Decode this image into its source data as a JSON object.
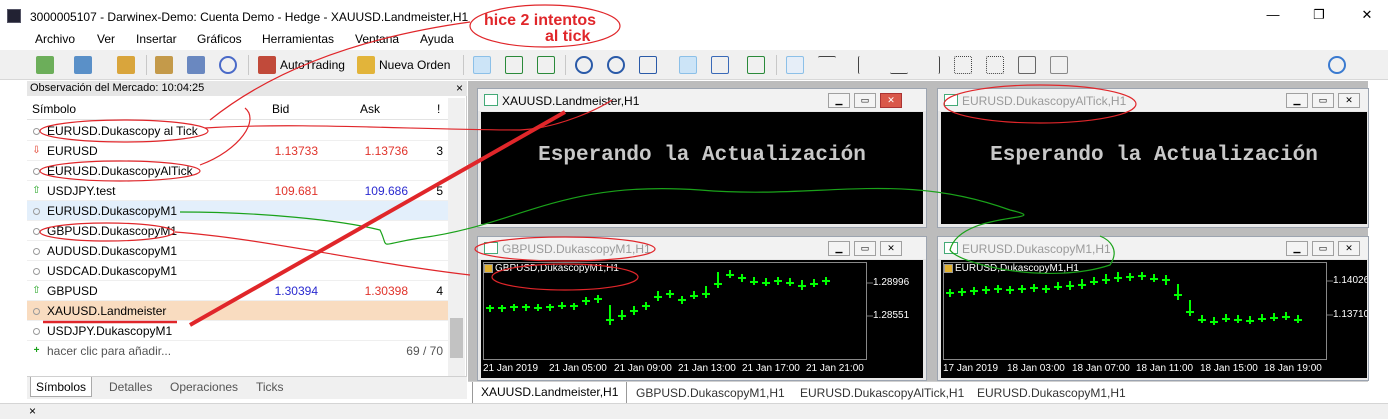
{
  "window": {
    "title": "3000005107 - Darwinex-Demo: Cuenta Demo - Hedge - XAUUSD.Landmeister,H1",
    "minimize": "—",
    "maximize": "❐",
    "close": "✕"
  },
  "menu": [
    "Archivo",
    "Ver",
    "Insertar",
    "Gráficos",
    "Herramientas",
    "Ventana",
    "Ayuda"
  ],
  "toolbar": {
    "autotrading_label": "AutoTrading",
    "new_order_label": "Nueva Orden"
  },
  "annotation": {
    "line1": "hice 2 intentos",
    "line2": "al tick"
  },
  "market_watch": {
    "header": "Observación del Mercado: 10:04:25",
    "close": "×",
    "columns": {
      "symbol": "Símbolo",
      "bid": "Bid",
      "ask": "Ask",
      "spread": "!"
    },
    "rows": [
      {
        "symbol": "EURUSD.Dukascopy al Tick",
        "bid": "",
        "ask": "",
        "spread": "",
        "icon": "dot"
      },
      {
        "symbol": "EURUSD",
        "bid": "1.13733",
        "ask": "1.13736",
        "spread": "3",
        "icon": "down-arrow"
      },
      {
        "symbol": "EURUSD.DukascopyAlTick",
        "bid": "",
        "ask": "",
        "spread": "",
        "icon": "dot"
      },
      {
        "symbol": "USDJPY.test",
        "bid": "109.681",
        "ask": "109.686",
        "spread": "5",
        "icon": "up-arrow"
      },
      {
        "symbol": "EURUSD.DukascopyM1",
        "bid": "",
        "ask": "",
        "spread": "",
        "icon": "dot"
      },
      {
        "symbol": "GBPUSD.DukascopyM1",
        "bid": "",
        "ask": "",
        "spread": "",
        "icon": "dot"
      },
      {
        "symbol": "AUDUSD.DukascopyM1",
        "bid": "",
        "ask": "",
        "spread": "",
        "icon": "dot"
      },
      {
        "symbol": "USDCAD.DukascopyM1",
        "bid": "",
        "ask": "",
        "spread": "",
        "icon": "dot"
      },
      {
        "symbol": "GBPUSD",
        "bid": "1.30394",
        "ask": "1.30398",
        "spread": "4",
        "icon": "up-arrow"
      },
      {
        "symbol": "XAUUSD.Landmeister",
        "bid": "",
        "ask": "",
        "spread": "",
        "icon": "dot"
      },
      {
        "symbol": "USDJPY.DukascopyM1",
        "bid": "",
        "ask": "",
        "spread": "",
        "icon": "dot"
      }
    ],
    "add_row": "hacer clic para añadir...",
    "count": "69 / 70",
    "tabs": [
      "Símbolos",
      "Detalles",
      "Operaciones",
      "Ticks"
    ]
  },
  "charts": {
    "xauusd": {
      "title": "XAUUSD.Landmeister,H1",
      "message": "Esperando la Actualización"
    },
    "eurusd_altick": {
      "title": "EURUSD.DukascopyAlTick,H1",
      "message": "Esperando la Actualización"
    },
    "gbpusd": {
      "title": "GBPUSD.DukascopyM1,H1",
      "subtitle": "GBPUSD,DukascopyM1,H1",
      "price_high": "1.28996",
      "price_low": "1.28551",
      "times": [
        "21 Jan 2019",
        "21 Jan 05:00",
        "21 Jan 09:00",
        "21 Jan 13:00",
        "21 Jan 17:00",
        "21 Jan 21:00"
      ]
    },
    "eurusd_m1": {
      "title": "EURUSD.DukascopyM1,H1",
      "subtitle": "EURUSD,DukascopyM1,H1",
      "price_high": "1.14026",
      "price_low": "1.13710",
      "times": [
        "17 Jan 2019",
        "18 Jan 03:00",
        "18 Jan 07:00",
        "18 Jan 11:00",
        "18 Jan 15:00",
        "18 Jan 19:00"
      ]
    }
  },
  "chart_tabs": [
    "XAUUSD.Landmeister,H1",
    "GBPUSD.DukascopyM1,H1",
    "EURUSD.DukascopyAlTick,H1",
    "EURUSD.DukascopyM1,H1"
  ],
  "status_close": "×",
  "colors": {
    "bull": "#00ff00",
    "chart_bg": "#000000",
    "annotation": "#e0262a",
    "green_ink": "#1aa21a"
  }
}
